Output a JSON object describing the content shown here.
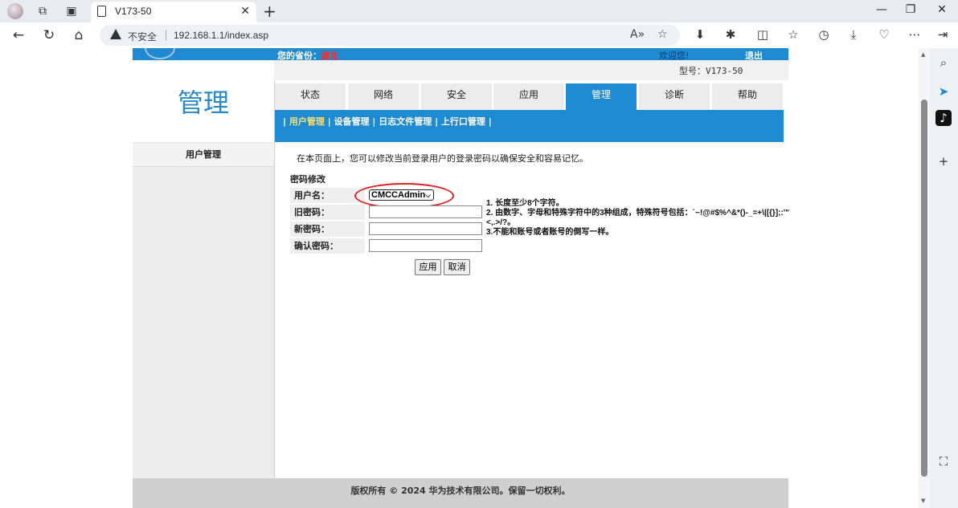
{
  "browser": {
    "tab_title": "V173-50",
    "security_label": "不安全",
    "url": "192.168.1.1/index.asp"
  },
  "header": {
    "province_label": "您的省份：",
    "province_value": "湖北",
    "welcome": "欢迎您!",
    "logout": "退出",
    "model": "型号：V173-50"
  },
  "sidebar": {
    "title": "管理",
    "items": [
      {
        "label": "用户管理"
      }
    ]
  },
  "main_tabs": [
    {
      "label": "状态"
    },
    {
      "label": "网络"
    },
    {
      "label": "安全"
    },
    {
      "label": "应用"
    },
    {
      "label": "管理"
    },
    {
      "label": "诊断"
    },
    {
      "label": "帮助"
    }
  ],
  "sub_nav": [
    "用户管理",
    "设备管理",
    "日志文件管理",
    "上行口管理"
  ],
  "content": {
    "description": "在本页面上，您可以修改当前登录用户的登录密码以确保安全和容易记忆。",
    "section_title": "密码修改",
    "username_label": "用户名：",
    "username_value": "CMCCAdmin",
    "old_password_label": "旧密码：",
    "new_password_label": "新密码：",
    "confirm_password_label": "确认密码：",
    "hints": [
      "1. 长度至少8个字符。",
      "2. 由数字、字母和特殊字符中的3种组成，特殊符号包括：`~!@#$%^&*()-_=+\\|[{}];:'\"<,.>/?。",
      "3.不能和账号或者账号的倒写一样。"
    ],
    "apply_button": "应用",
    "cancel_button": "取消"
  },
  "footer": {
    "copyright": "版权所有 © 2024 华为技术有限公司。保留一切权利。"
  },
  "colors": {
    "primary_blue": "#1f8ad1",
    "highlight_red": "#e02020"
  }
}
